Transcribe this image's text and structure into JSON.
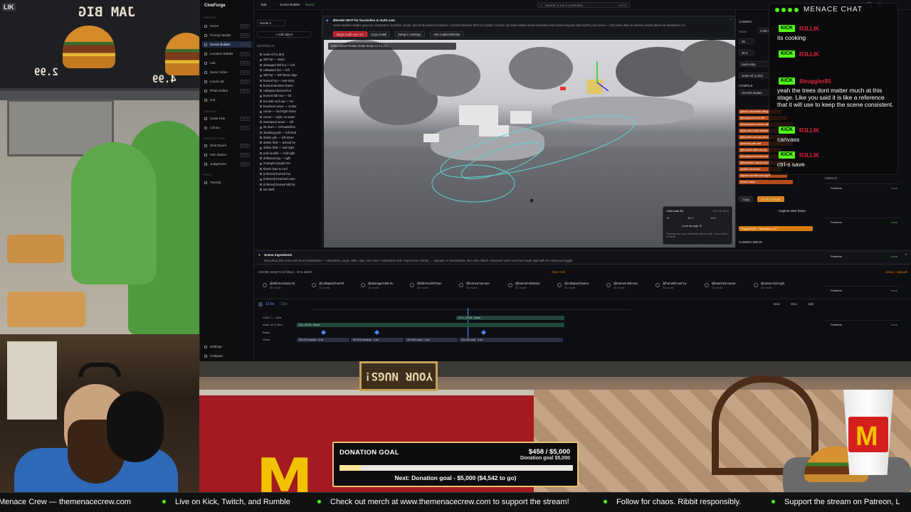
{
  "pixel_panel": {
    "board_title": "JAM BIG",
    "prices": [
      "2.99",
      "4.99"
    ],
    "corner_badge": "LIK"
  },
  "app": {
    "name": "CineForge",
    "sidebar": {
      "sections": [
        "CREATE",
        "LIBRARY",
        "PRODUCTION",
        "HELP"
      ],
      "items": [
        {
          "label": "Home",
          "kb": "Ctrl+1"
        },
        {
          "label": "Prompt Studio",
          "kb": "Ctrl+2"
        },
        {
          "label": "Scene Builder",
          "kb": "Ctrl+3"
        },
        {
          "label": "Location Builder",
          "kb": "Ctrl+4"
        },
        {
          "label": "Lab",
          "kb": "Ctrl+5"
        },
        {
          "label": "Music Video",
          "kb": "Ctrl+6"
        },
        {
          "label": "Local Lab",
          "kb": "Ctrl+7"
        },
        {
          "label": "Photo Editor",
          "kb": "Ctrl+8"
        },
        {
          "label": "Cut",
          "kb": ""
        },
        {
          "label": "Asset Hub",
          "kb": "Ctrl+9"
        },
        {
          "label": "Library",
          "kb": "Ctrl+L"
        },
        {
          "label": "Shot Board",
          "kb": "Ctrl+B"
        },
        {
          "label": "Gen Space",
          "kb": "Ctrl+G"
        },
        {
          "label": "Judgement",
          "kb": "Ctrl+J"
        },
        {
          "label": "Tutorial",
          "kb": ""
        },
        {
          "label": "Settings",
          "kb": ""
        },
        {
          "label": "Collapse",
          "kb": ""
        }
      ]
    },
    "topbar": {
      "project": "test",
      "crumb": "Scene Builder",
      "status": "saved",
      "search_placeholder": "Search or run a command...",
      "search_kb": "Ctrl+K"
    },
    "scenes": {
      "scene_select": "Scene 1",
      "add_object": "+ Add object",
      "header": "ENTITIES 35",
      "entities": [
        "scale ref (1.8m)",
        "stilt hut — intact",
        "damaged stilt hut — left",
        "collapsed hut — left",
        "stilt hut — left frame edge",
        "burned hut — two-story",
        "burned skeleton frame",
        "collapsed burned hut",
        "burned stilt row — far",
        "hut with roof cap — far",
        "beached canoe — center",
        "canoe — mid-right shore",
        "canoe — right, on water",
        "swamped canoe — left",
        "oil drum — left waterline",
        "standing pole — left shal",
        "debris pile — left shore",
        "debris field — behind he",
        "debris field — mid-right",
        "pole bundle — mid-right",
        "driftwood log — right",
        "emergent jungle tree",
        "thatch lean-to roof",
        "(inferred) burned hut",
        "(inferred) beached cano",
        "(inferred) burned stilt ho",
        "set shell"
      ]
    },
    "notice": {
      "title": "Blender MCP for facsimiles & multi-cam",
      "body": "Scene Builder stages grey-box characters, locations, props, and multi-camera timelines. Connect Blender MCP to Copilot / Cursor can build simple mesh facsimiles and camera layouts that match your scene — the same data of camera control driven as Seedance 2.0.",
      "buttons": [
        "Begin multi-cam set",
        "Copy install",
        "Setup in Settings",
        "Ask Copilot Blender"
      ]
    },
    "viewport": {
      "toolbar": "Select  Move  Rotate  Scale  Snap  0.2  1:1  0.1",
      "cam_title": "CAM craft 3/4",
      "cam_meta": "16:9  4K  50%",
      "cam_vals": [
        "49",
        "36.3",
        "16:9"
      ],
      "cam_look": "Look through ①",
      "cam_note": "Floating cam over Seedance direct route. Lens: 35mm in frame."
    },
    "right_panel": {
      "header": "CAMERA",
      "name_label": "Name",
      "name_value": "CAM 1",
      "fields": [
        "49",
        "36.3",
        "back entry",
        "scale ref (1.8m)"
      ],
      "compile_label": "COMPILE",
      "compile_value": "SH-010 master",
      "tags": [
        "@act3-shoreline-village",
        "@collapsed-hut-left",
        "@swamped-canoe-left",
        "@oil-drum-left-waterline",
        "@burned-hut-two-story",
        "@debris-pile-left",
        "@burned-stilt-row-far",
        "@collapsed-burned-hut",
        "@beached-canoe-center",
        "@stilt-hut-intact",
        "@pole-bundle-mid-right",
        "@act2-style"
      ],
      "buttons": [
        "Copy",
        "Send to Studio"
      ],
      "export_label": "Export KDV · Seedance 2.0",
      "capture_label": "Capture start frame",
      "camera_drive": "CAMERA DRIVE"
    },
    "ingredients": {
      "title": "Scene ingredients",
      "body": "Everything this scene will send downstream — characters, props, stills, clips, and voice / expression sets. Import from Library → Uploads or Generations, then click Attach. Advanced users can then tweak tags with the Advanced toggle."
    },
    "assets": {
      "header": "SCENE ASSETS  33 linked · 48 to attach",
      "open_hub": "Open Hub",
      "lib_link": "Library / Uploads",
      "items": [
        {
          "name": "@stilt-hut-intact-23",
          "sub": "3D model"
        },
        {
          "name": "@collapsed-hut-lef",
          "sub": "3D model"
        },
        {
          "name": "@damaged-stilt-hu",
          "sub": "3D model"
        },
        {
          "name": "@stilt-hut-left-fram",
          "sub": "3D model"
        },
        {
          "name": "@burned-hut-two-",
          "sub": "3D model"
        },
        {
          "name": "@burned-skeleton-",
          "sub": "3D model"
        },
        {
          "name": "@collapsed-burne",
          "sub": "3D model"
        },
        {
          "name": "@burned-stilt-row-",
          "sub": "3D model"
        },
        {
          "name": "@hut-with-roof-ca",
          "sub": "3D model"
        },
        {
          "name": "@beached-canoe-",
          "sub": "3D model"
        },
        {
          "name": "@canoe-mid-right",
          "sub": "3D model"
        }
      ]
    },
    "timeline": {
      "time": "12.8s",
      "duration": "/ 23s",
      "tracks": [
        "CAM 1 — wide",
        "scale ref (1.8m)",
        "Beats",
        "Shots"
      ],
      "clips": [
        "0.0—23.0s · linear",
        "12.0—23.0s · linear",
        "SH-010 master · 4.0s",
        "SH-020 medium · 4.5s",
        "SH-030 close · 4.0s",
        "SH-040 orbit · 4.5s"
      ],
      "controls": [
        "Beat",
        "Shot",
        "Split"
      ]
    }
  },
  "chat": {
    "title": "MENACE CHAT",
    "badge": "KICK",
    "messages": [
      {
        "user": "R3LLIK",
        "text": "its cooking",
        "color": "#e0253b"
      },
      {
        "user": "R3LLIK",
        "text": "",
        "color": "#e0253b"
      },
      {
        "user": "Struggler85",
        "text": "yeah the trees dont matter much at this stage. Like you said it is like a reference that it will use to keep the scene consistent.",
        "color": "#e0253b"
      },
      {
        "user": "R3LLIK",
        "text": "canvass",
        "color": "#e0253b"
      },
      {
        "user": "R3LLIK",
        "text": "ctrl-s save",
        "color": "#e0253b"
      }
    ]
  },
  "logs": {
    "title": "COPILOT",
    "items": [
      "Freeform",
      "Freeform",
      "Freeform",
      "Freeform",
      "Freeform"
    ],
    "status": "done"
  },
  "game": {
    "sign": "YOUR NUGS!",
    "logo": "M"
  },
  "donation": {
    "title": "DONATION GOAL",
    "amount": "$458 / $5,000",
    "subtitle": "Donation goal $5,000",
    "progress": 0.0916,
    "next": "Next: Donation goal - $5,000 ($4,542 to go)"
  },
  "ticker": [
    "Menace Crew — themenacecrew.com",
    "Live on Kick, Twitch, and Rumble",
    "Check out merch at www.themenacecrew.com to support the stream!",
    "Follow for chaos. Ribbit responsibly.",
    "Support the stream on Patreon, L"
  ],
  "colors": {
    "kick_green": "#53fc18",
    "gold": "#e8c36a",
    "app_accent": "#d97b12",
    "teal_path": "#5fd4d0"
  }
}
